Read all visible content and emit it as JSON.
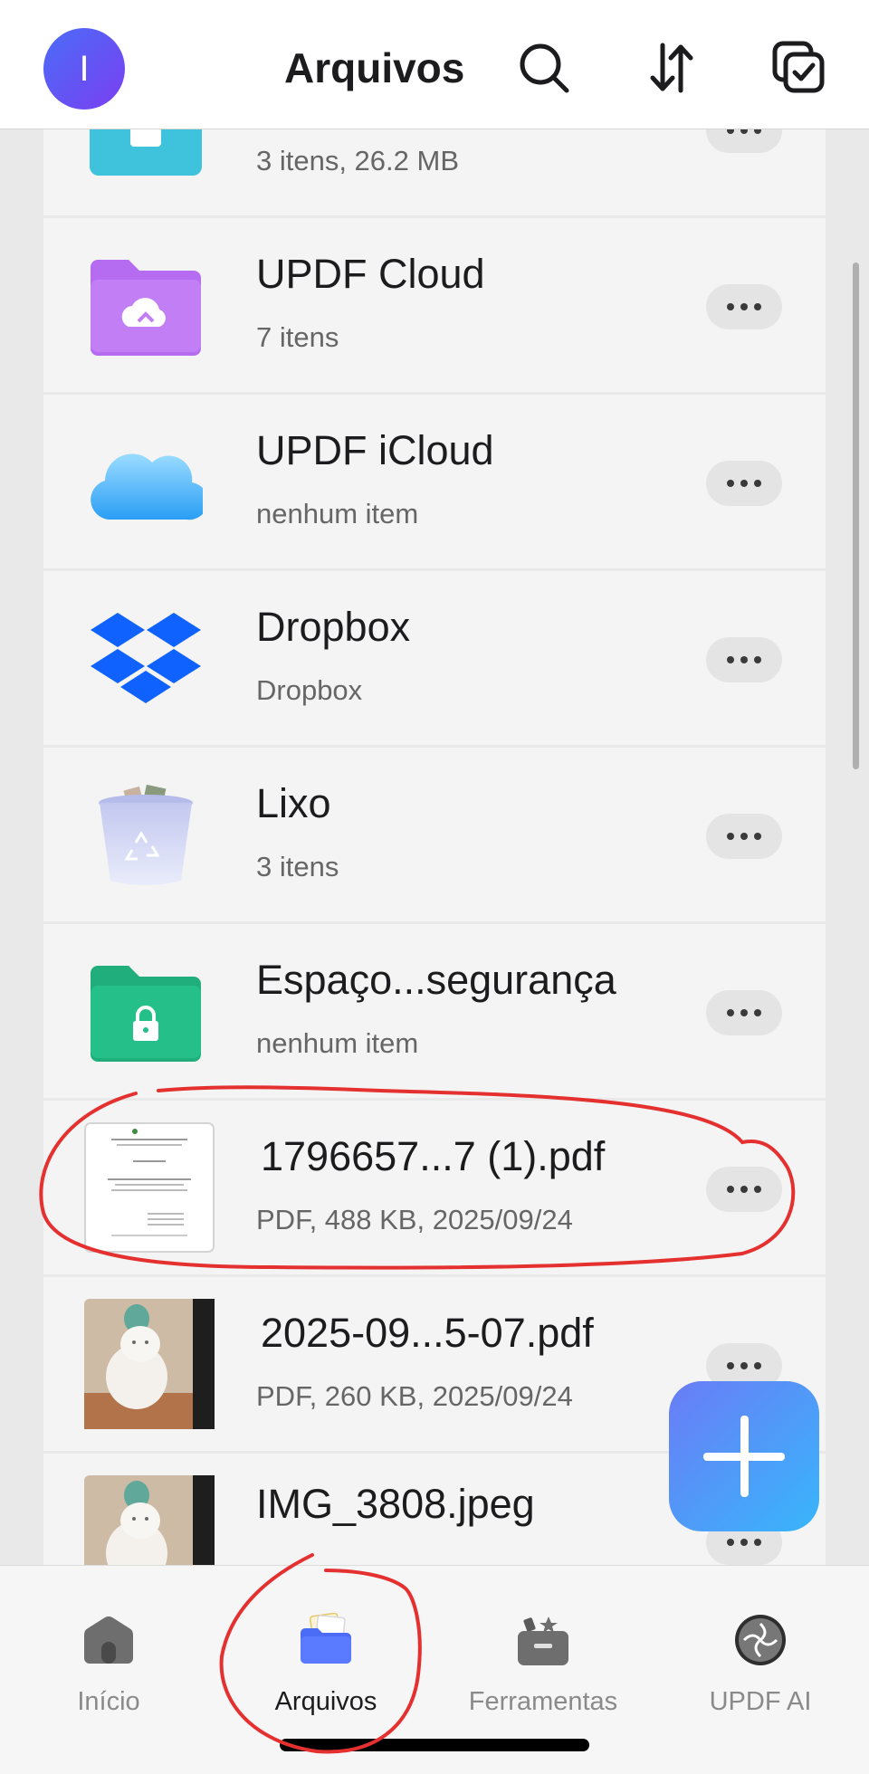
{
  "header": {
    "avatar_initial": "I",
    "title": "Arquivos",
    "icons": [
      "search-icon",
      "sort-icon",
      "select-icon"
    ]
  },
  "files": [
    {
      "name": "",
      "subtitle": "3 itens, 26.2 MB",
      "icon": "usb-drive-icon"
    },
    {
      "name": "UPDF Cloud",
      "subtitle": "7 itens",
      "icon": "cloud-folder-icon"
    },
    {
      "name": "UPDF iCloud",
      "subtitle": "nenhum item",
      "icon": "icloud-icon"
    },
    {
      "name": "Dropbox",
      "subtitle": "Dropbox",
      "icon": "dropbox-icon"
    },
    {
      "name": "Lixo",
      "subtitle": "3 itens",
      "icon": "trash-icon"
    },
    {
      "name": "Espaço...segurança",
      "subtitle": "nenhum item",
      "icon": "secure-folder-icon"
    },
    {
      "name": "1796657...7 (1).pdf",
      "subtitle": "PDF, 488 KB, 2025/09/24",
      "icon": "pdf-document-thumbnail"
    },
    {
      "name": "2025-09...5-07.pdf",
      "subtitle": "PDF, 260 KB, 2025/09/24",
      "icon": "cat-photo-thumbnail"
    },
    {
      "name": "IMG_3808.jpeg",
      "subtitle": "",
      "icon": "cat-photo-thumbnail"
    }
  ],
  "fab": {
    "icon": "plus-icon"
  },
  "tabs": [
    {
      "label": "Início",
      "icon": "home-icon",
      "active": false
    },
    {
      "label": "Arquivos",
      "icon": "folder-icon",
      "active": true
    },
    {
      "label": "Ferramentas",
      "icon": "toolbox-icon",
      "active": false
    },
    {
      "label": "UPDF AI",
      "icon": "ai-icon",
      "active": false
    }
  ],
  "colors": {
    "accent_blue": "#4a6cf7",
    "annotation_red": "#e53030",
    "cloud_folder": "#b56cf0",
    "secure_folder": "#25c08a",
    "dropbox": "#0f62fe"
  }
}
